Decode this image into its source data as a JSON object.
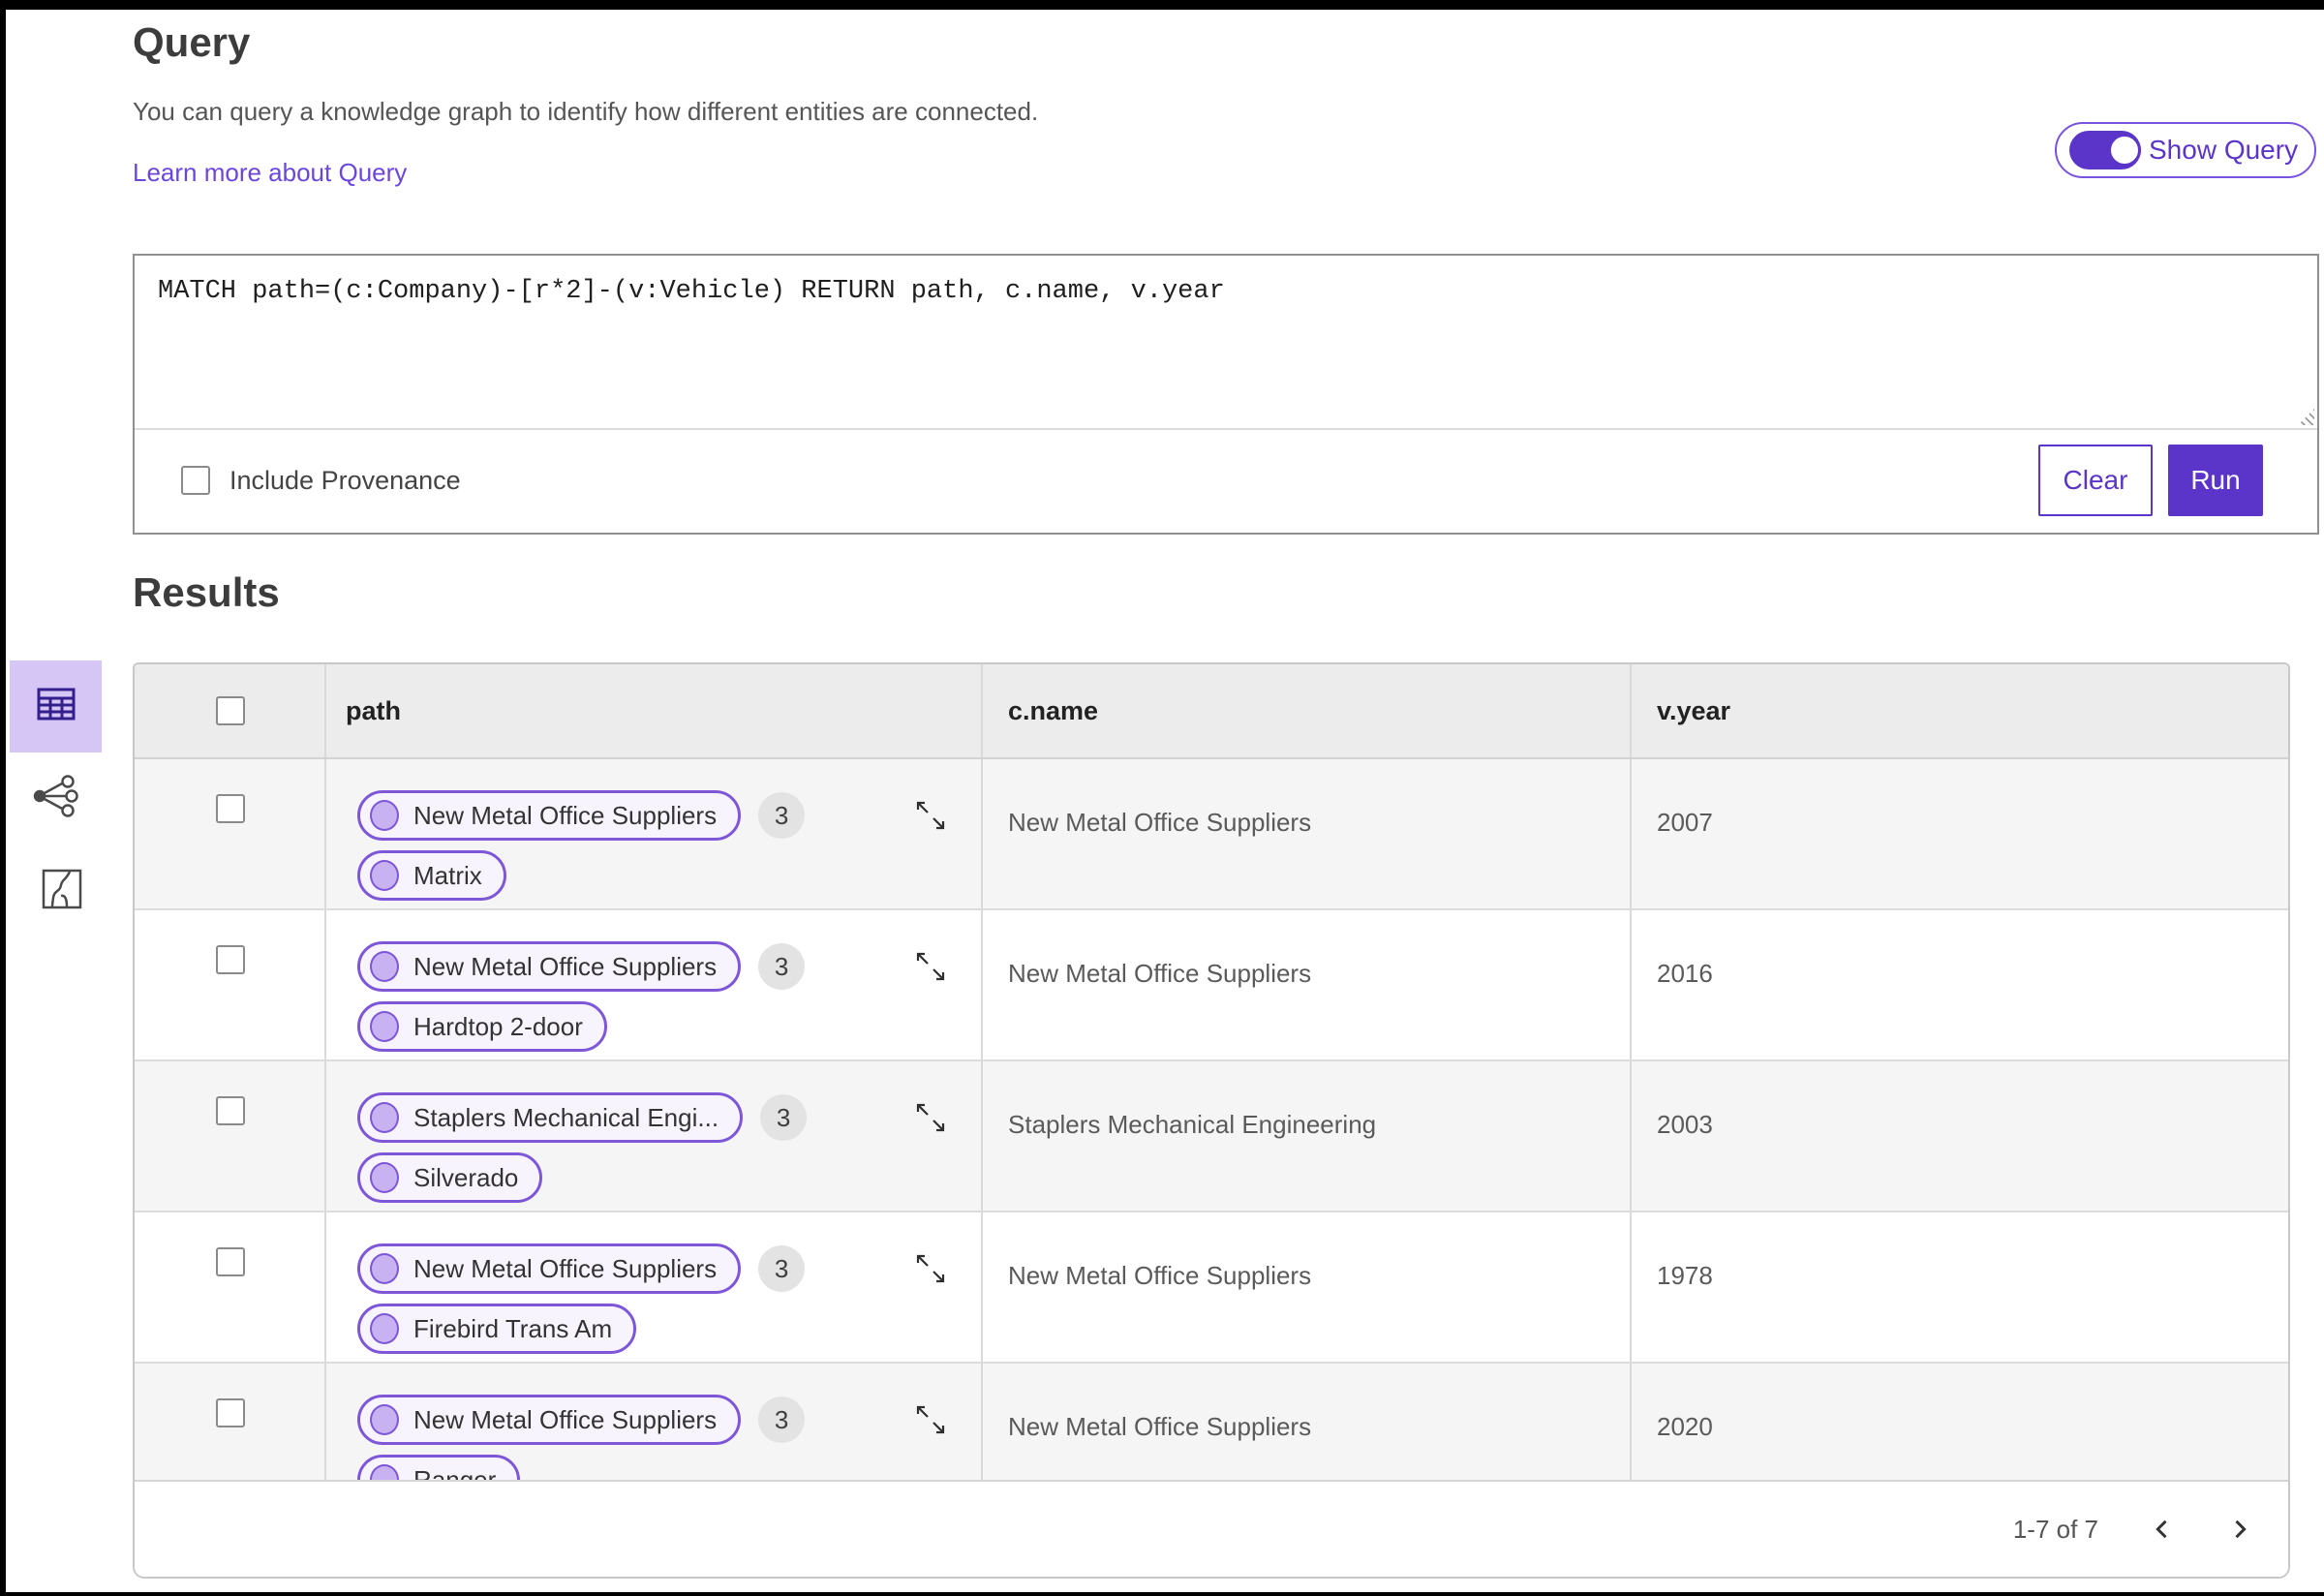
{
  "header": {
    "title": "Query",
    "description": "You can query a knowledge graph to identify how different entities are connected.",
    "learn_more_link": "Learn more about Query",
    "show_query_toggle": {
      "label": "Show Query",
      "state": "on"
    }
  },
  "query_editor": {
    "query_text": "MATCH path=(c:Company)-[r*2]-(v:Vehicle) RETURN path, c.name, v.year",
    "include_provenance": {
      "label": "Include Provenance",
      "checked": false
    },
    "buttons": {
      "clear": "Clear",
      "run": "Run"
    }
  },
  "results": {
    "heading": "Results",
    "views": [
      {
        "icon": "table-view-icon",
        "selected": true
      },
      {
        "icon": "graph-view-icon",
        "selected": false
      },
      {
        "icon": "chart-view-icon",
        "selected": false
      }
    ],
    "table": {
      "columns": [
        "path",
        "c.name",
        "v.year"
      ],
      "rows": [
        {
          "path_start_node": "New Metal Office Suppliers",
          "path_badge_count": "3",
          "path_end_node": "Matrix",
          "c_name": "New Metal Office Suppliers",
          "v_year": "2007"
        },
        {
          "path_start_node": "New Metal Office Suppliers",
          "path_badge_count": "3",
          "path_end_node": "Hardtop 2-door",
          "c_name": "New Metal Office Suppliers",
          "v_year": "2016"
        },
        {
          "path_start_node": "Staplers Mechanical Engi...",
          "path_badge_count": "3",
          "path_end_node": "Silverado",
          "c_name": "Staplers Mechanical Engineering",
          "v_year": "2003"
        },
        {
          "path_start_node": "New Metal Office Suppliers",
          "path_badge_count": "3",
          "path_end_node": "Firebird Trans Am",
          "c_name": "New Metal Office Suppliers",
          "v_year": "1978"
        },
        {
          "path_start_node": "New Metal Office Suppliers",
          "path_badge_count": "3",
          "path_end_node": "Ranger",
          "c_name": "New Metal Office Suppliers",
          "v_year": "2020"
        }
      ]
    },
    "pagination": {
      "range_label": "1-7 of 7",
      "prev_icon": "chevron-left-icon",
      "next_icon": "chevron-right-icon"
    }
  },
  "colors": {
    "accent_purple": "#5b35c9",
    "toggle_border_purple": "#7a52e0",
    "pill_border": "#7e57d8",
    "pill_background": "#f7f4fe",
    "node_circle_fill": "#c9b2f2",
    "selected_view_background": "#d6c6f6",
    "link_purple": "#6b46dd",
    "table_header_background": "#ececec",
    "alt_row_background": "#f5f5f5",
    "badge_background": "#e3e3e3"
  }
}
